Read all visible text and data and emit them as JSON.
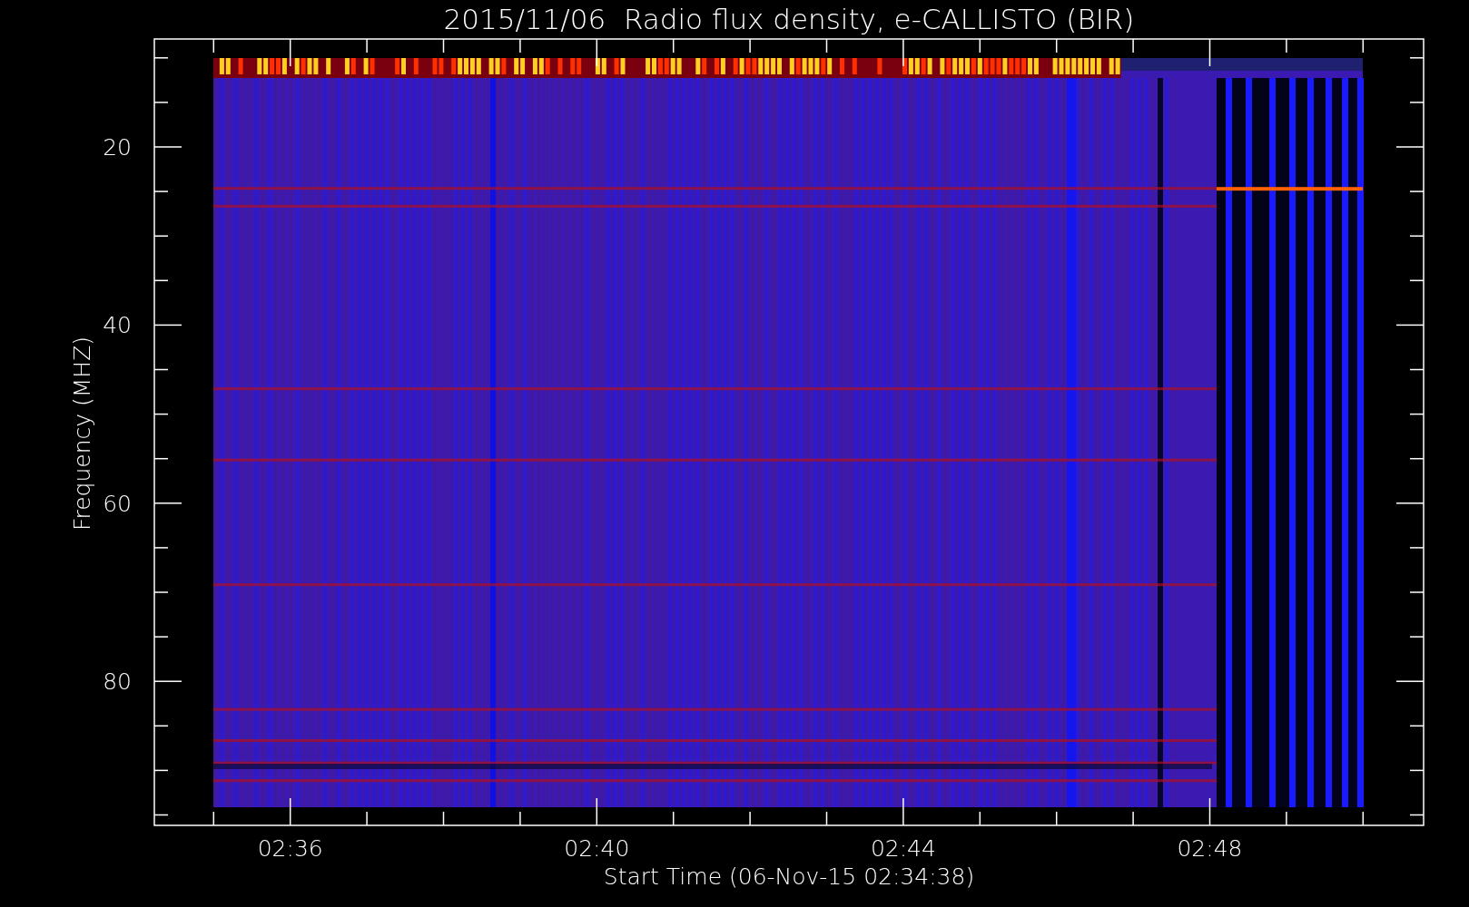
{
  "plot": {
    "title": "2015/11/06  Radio flux density, e-CALLISTO (BIR)",
    "ylabel": "Frequency (MHZ)",
    "xlabel": "Start Time (06-Nov-15 02:34:38)",
    "y_tick_labels": [
      "20",
      "40",
      "60",
      "80"
    ],
    "x_tick_labels": [
      "02:36",
      "02:40",
      "02:44",
      "02:48"
    ]
  }
}
